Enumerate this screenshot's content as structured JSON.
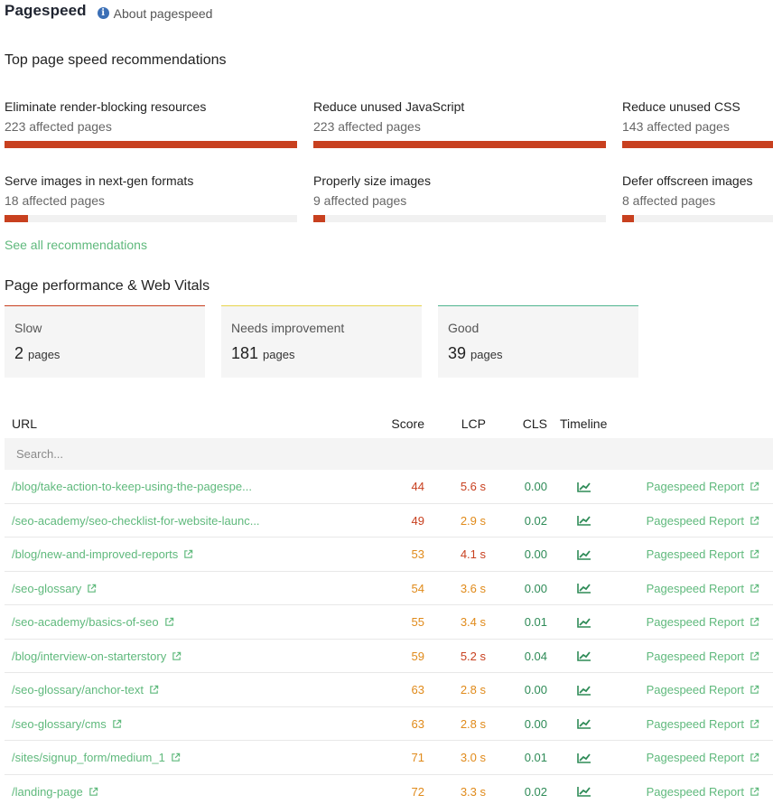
{
  "header": {
    "title": "Pagespeed",
    "about_label": "About pagespeed",
    "info_icon": "info-icon"
  },
  "recommendations": {
    "title": "Top page speed recommendations",
    "items": [
      {
        "label": "Eliminate render-blocking resources",
        "count": "223 affected pages",
        "fill": 1.0
      },
      {
        "label": "Reduce unused JavaScript",
        "count": "223 affected pages",
        "fill": 1.0
      },
      {
        "label": "Reduce unused CSS",
        "count": "143 affected pages",
        "fill": 0.64
      },
      {
        "label": "Serve images in next-gen formats",
        "count": "18 affected pages",
        "fill": 0.08
      },
      {
        "label": "Properly size images",
        "count": "9 affected pages",
        "fill": 0.04
      },
      {
        "label": "Defer offscreen images",
        "count": "8 affected pages",
        "fill": 0.04
      }
    ],
    "bar_color": "#c8401f",
    "see_all": "See all recommendations"
  },
  "performance": {
    "title": "Page performance & Web Vitals",
    "cards": [
      {
        "label": "Slow",
        "value": "2",
        "unit": "pages",
        "color": "#c8401f"
      },
      {
        "label": "Needs improvement",
        "value": "181",
        "unit": "pages",
        "color": "#e8d44d"
      },
      {
        "label": "Good",
        "value": "39",
        "unit": "pages",
        "color": "#4fb58f"
      }
    ]
  },
  "table": {
    "columns": {
      "url": "URL",
      "score": "Score",
      "lcp": "LCP",
      "cls": "CLS",
      "timeline": "Timeline"
    },
    "search_placeholder": "Search...",
    "report_label": "Pagespeed Report",
    "rows": [
      {
        "url": "/blog/take-action-to-keep-using-the-pagespe...",
        "score": "44",
        "score_status": "red",
        "lcp": "5.6 s",
        "lcp_status": "red",
        "cls": "0.00",
        "ext": false
      },
      {
        "url": "/seo-academy/seo-checklist-for-website-launc...",
        "score": "49",
        "score_status": "red",
        "lcp": "2.9 s",
        "lcp_status": "orange",
        "cls": "0.02",
        "ext": false
      },
      {
        "url": "/blog/new-and-improved-reports",
        "score": "53",
        "score_status": "orange",
        "lcp": "4.1 s",
        "lcp_status": "red",
        "cls": "0.00",
        "ext": true
      },
      {
        "url": "/seo-glossary",
        "score": "54",
        "score_status": "orange",
        "lcp": "3.6 s",
        "lcp_status": "orange",
        "cls": "0.00",
        "ext": true
      },
      {
        "url": "/seo-academy/basics-of-seo",
        "score": "55",
        "score_status": "orange",
        "lcp": "3.4 s",
        "lcp_status": "orange",
        "cls": "0.01",
        "ext": true
      },
      {
        "url": "/blog/interview-on-starterstory",
        "score": "59",
        "score_status": "orange",
        "lcp": "5.2 s",
        "lcp_status": "red",
        "cls": "0.04",
        "ext": true
      },
      {
        "url": "/seo-glossary/anchor-text",
        "score": "63",
        "score_status": "orange",
        "lcp": "2.8 s",
        "lcp_status": "orange",
        "cls": "0.00",
        "ext": true
      },
      {
        "url": "/seo-glossary/cms",
        "score": "63",
        "score_status": "orange",
        "lcp": "2.8 s",
        "lcp_status": "orange",
        "cls": "0.00",
        "ext": true
      },
      {
        "url": "/sites/signup_form/medium_1",
        "score": "71",
        "score_status": "orange",
        "lcp": "3.0 s",
        "lcp_status": "orange",
        "cls": "0.01",
        "ext": true
      },
      {
        "url": "/landing-page",
        "score": "72",
        "score_status": "orange",
        "lcp": "3.3 s",
        "lcp_status": "orange",
        "cls": "0.02",
        "ext": true
      }
    ]
  }
}
